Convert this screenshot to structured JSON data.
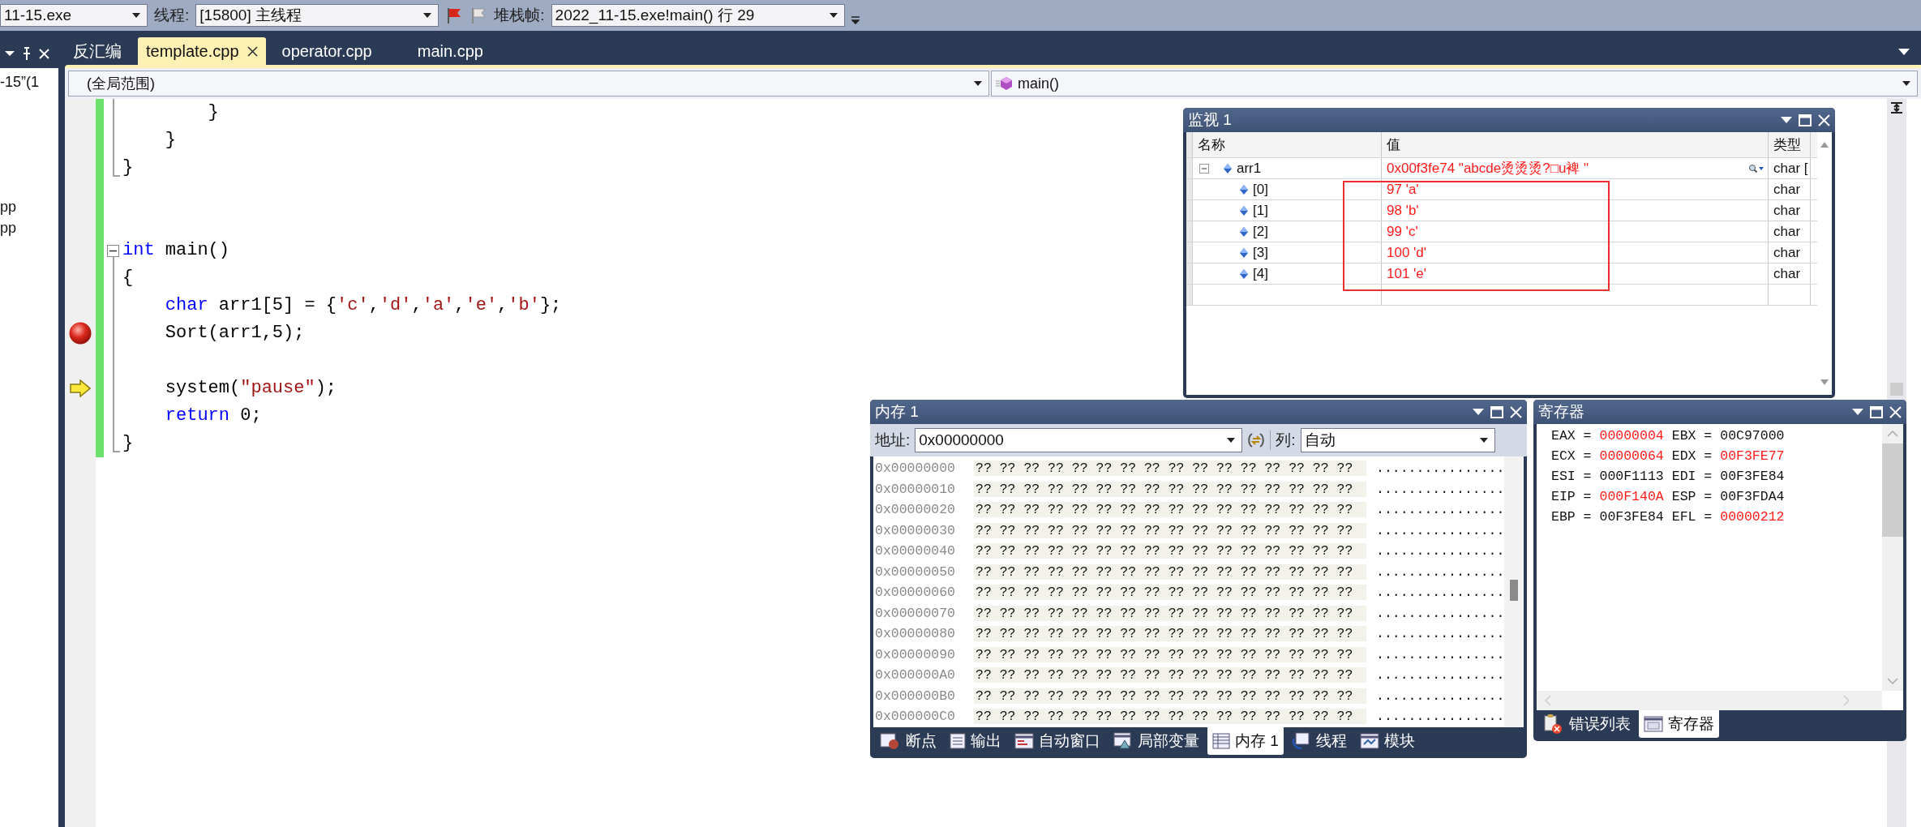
{
  "toolbar": {
    "process": "11-15.exe",
    "thread_label": "线程:",
    "thread": "[15800] 主线程",
    "frame_label": "堆栈帧:",
    "frame": "2022_11-15.exe!main()  行 29"
  },
  "side_panel": {
    "lines": [
      "-15”(1",
      "pp",
      "pp"
    ]
  },
  "doc_tabs": [
    {
      "label": "反汇编",
      "selected": false
    },
    {
      "label": "template.cpp",
      "selected": true
    },
    {
      "label": "operator.cpp",
      "selected": false
    },
    {
      "label": "main.cpp",
      "selected": false
    }
  ],
  "nav": {
    "scope": "(全局范围)",
    "member": "main()"
  },
  "code": [
    {
      "in_block": true,
      "tokens": [
        {
          "kind": "plain",
          "text": "        }"
        }
      ]
    },
    {
      "in_block": true,
      "tokens": [
        {
          "kind": "plain",
          "text": "    }"
        }
      ]
    },
    {
      "block_end": true,
      "tokens": [
        {
          "kind": "plain",
          "text": "}"
        }
      ]
    },
    {
      "in_block": false
    },
    {
      "in_block": false
    },
    {
      "collapsible": true,
      "tokens": [
        {
          "kind": "keyword",
          "text": "int"
        },
        {
          "kind": "plain",
          "text": " main()"
        }
      ]
    },
    {
      "in_block": true,
      "tokens": [
        {
          "kind": "plain",
          "text": "{"
        }
      ]
    },
    {
      "in_block": true,
      "tokens": [
        {
          "kind": "keyword",
          "text": "    char"
        },
        {
          "kind": "plain",
          "text": " arr1[5] = {"
        },
        {
          "kind": "string",
          "text": "'c'"
        },
        {
          "kind": "plain",
          "text": ","
        },
        {
          "kind": "string",
          "text": "'d'"
        },
        {
          "kind": "plain",
          "text": ","
        },
        {
          "kind": "string",
          "text": "'a'"
        },
        {
          "kind": "plain",
          "text": ","
        },
        {
          "kind": "string",
          "text": "'e'"
        },
        {
          "kind": "plain",
          "text": ","
        },
        {
          "kind": "string",
          "text": "'b'"
        },
        {
          "kind": "plain",
          "text": "};"
        }
      ]
    },
    {
      "in_block": true,
      "breakpoint": true,
      "tokens": [
        {
          "kind": "plain",
          "text": "    Sort(arr1,5);"
        }
      ]
    },
    {
      "in_block": true
    },
    {
      "in_block": true,
      "current": true,
      "tokens": [
        {
          "kind": "plain",
          "text": "    system("
        },
        {
          "kind": "string",
          "text": "\"pause\""
        },
        {
          "kind": "plain",
          "text": ");"
        }
      ]
    },
    {
      "in_block": true,
      "tokens": [
        {
          "kind": "keyword",
          "text": "    return"
        },
        {
          "kind": "plain",
          "text": " 0;"
        }
      ]
    },
    {
      "block_end": true,
      "tokens": [
        {
          "kind": "plain",
          "text": "}"
        }
      ]
    }
  ],
  "watch": {
    "title": "监视 1",
    "columns": [
      "名称",
      "值",
      "类型"
    ],
    "rows": [
      {
        "name": "arr1",
        "value": "0x00f3fe74 \"abcde烫烫烫?□u裨    \"",
        "type": "char [",
        "changed": true,
        "expanded": true,
        "children": [
          {
            "name": "[0]",
            "value": "97 'a'",
            "type": "char",
            "changed": true
          },
          {
            "name": "[1]",
            "value": "98 'b'",
            "type": "char",
            "changed": true
          },
          {
            "name": "[2]",
            "value": "99 'c'",
            "type": "char",
            "changed": true
          },
          {
            "name": "[3]",
            "value": "100 'd'",
            "type": "char",
            "changed": true
          },
          {
            "name": "[4]",
            "value": "101 'e'",
            "type": "char",
            "changed": true
          }
        ]
      }
    ]
  },
  "memory": {
    "title": "内存 1",
    "address_label": "地址:",
    "address": "0x00000000",
    "columns_label": "列:",
    "columns": "自动",
    "rows": [
      {
        "address": "0x00000000",
        "bytes": "?? ?? ?? ?? ?? ?? ?? ?? ?? ?? ?? ?? ?? ?? ?? ??",
        "text": "................"
      },
      {
        "address": "0x00000010",
        "bytes": "?? ?? ?? ?? ?? ?? ?? ?? ?? ?? ?? ?? ?? ?? ?? ??",
        "text": "................"
      },
      {
        "address": "0x00000020",
        "bytes": "?? ?? ?? ?? ?? ?? ?? ?? ?? ?? ?? ?? ?? ?? ?? ??",
        "text": "................"
      },
      {
        "address": "0x00000030",
        "bytes": "?? ?? ?? ?? ?? ?? ?? ?? ?? ?? ?? ?? ?? ?? ?? ??",
        "text": "................"
      },
      {
        "address": "0x00000040",
        "bytes": "?? ?? ?? ?? ?? ?? ?? ?? ?? ?? ?? ?? ?? ?? ?? ??",
        "text": "................"
      },
      {
        "address": "0x00000050",
        "bytes": "?? ?? ?? ?? ?? ?? ?? ?? ?? ?? ?? ?? ?? ?? ?? ??",
        "text": "................"
      },
      {
        "address": "0x00000060",
        "bytes": "?? ?? ?? ?? ?? ?? ?? ?? ?? ?? ?? ?? ?? ?? ?? ??",
        "text": "................"
      },
      {
        "address": "0x00000070",
        "bytes": "?? ?? ?? ?? ?? ?? ?? ?? ?? ?? ?? ?? ?? ?? ?? ??",
        "text": "................"
      },
      {
        "address": "0x00000080",
        "bytes": "?? ?? ?? ?? ?? ?? ?? ?? ?? ?? ?? ?? ?? ?? ?? ??",
        "text": "................"
      },
      {
        "address": "0x00000090",
        "bytes": "?? ?? ?? ?? ?? ?? ?? ?? ?? ?? ?? ?? ?? ?? ?? ??",
        "text": "................"
      },
      {
        "address": "0x000000A0",
        "bytes": "?? ?? ?? ?? ?? ?? ?? ?? ?? ?? ?? ?? ?? ?? ?? ??",
        "text": "................"
      },
      {
        "address": "0x000000B0",
        "bytes": "?? ?? ?? ?? ?? ?? ?? ?? ?? ?? ?? ?? ?? ?? ?? ??",
        "text": "................"
      },
      {
        "address": "0x000000C0",
        "bytes": "?? ?? ?? ?? ?? ?? ?? ?? ?? ?? ?? ?? ?? ?? ?? ??",
        "text": "................"
      }
    ],
    "tabs": [
      {
        "label": "断点",
        "selected": false
      },
      {
        "label": "输出",
        "selected": false
      },
      {
        "label": "自动窗口",
        "selected": false
      },
      {
        "label": "局部变量",
        "selected": false
      },
      {
        "label": "内存 1",
        "selected": true
      },
      {
        "label": "线程",
        "selected": false
      },
      {
        "label": "模块",
        "selected": false
      }
    ]
  },
  "registers": {
    "title": "寄存器",
    "lines": [
      [
        {
          "label": "EAX =",
          "value": "00000004",
          "changed": true
        },
        {
          "label": "EBX =",
          "value": "00C97000",
          "changed": false
        }
      ],
      [
        {
          "label": "ECX =",
          "value": "00000064",
          "changed": true
        },
        {
          "label": "EDX =",
          "value": "00F3FE77",
          "changed": true
        }
      ],
      [
        {
          "label": "ESI =",
          "value": "000F1113",
          "changed": false
        },
        {
          "label": "EDI =",
          "value": "00F3FE84",
          "changed": false
        }
      ],
      [
        {
          "label": "EIP =",
          "value": "000F140A",
          "changed": true
        },
        {
          "label": "ESP =",
          "value": "00F3FDA4",
          "changed": false
        }
      ],
      [
        {
          "label": "EBP =",
          "value": "00F3FE84",
          "changed": false
        },
        {
          "label": "EFL =",
          "value": "00000212",
          "changed": true
        }
      ]
    ],
    "tabs": [
      {
        "label": "错误列表",
        "selected": false
      },
      {
        "label": "寄存器",
        "selected": true
      }
    ]
  }
}
